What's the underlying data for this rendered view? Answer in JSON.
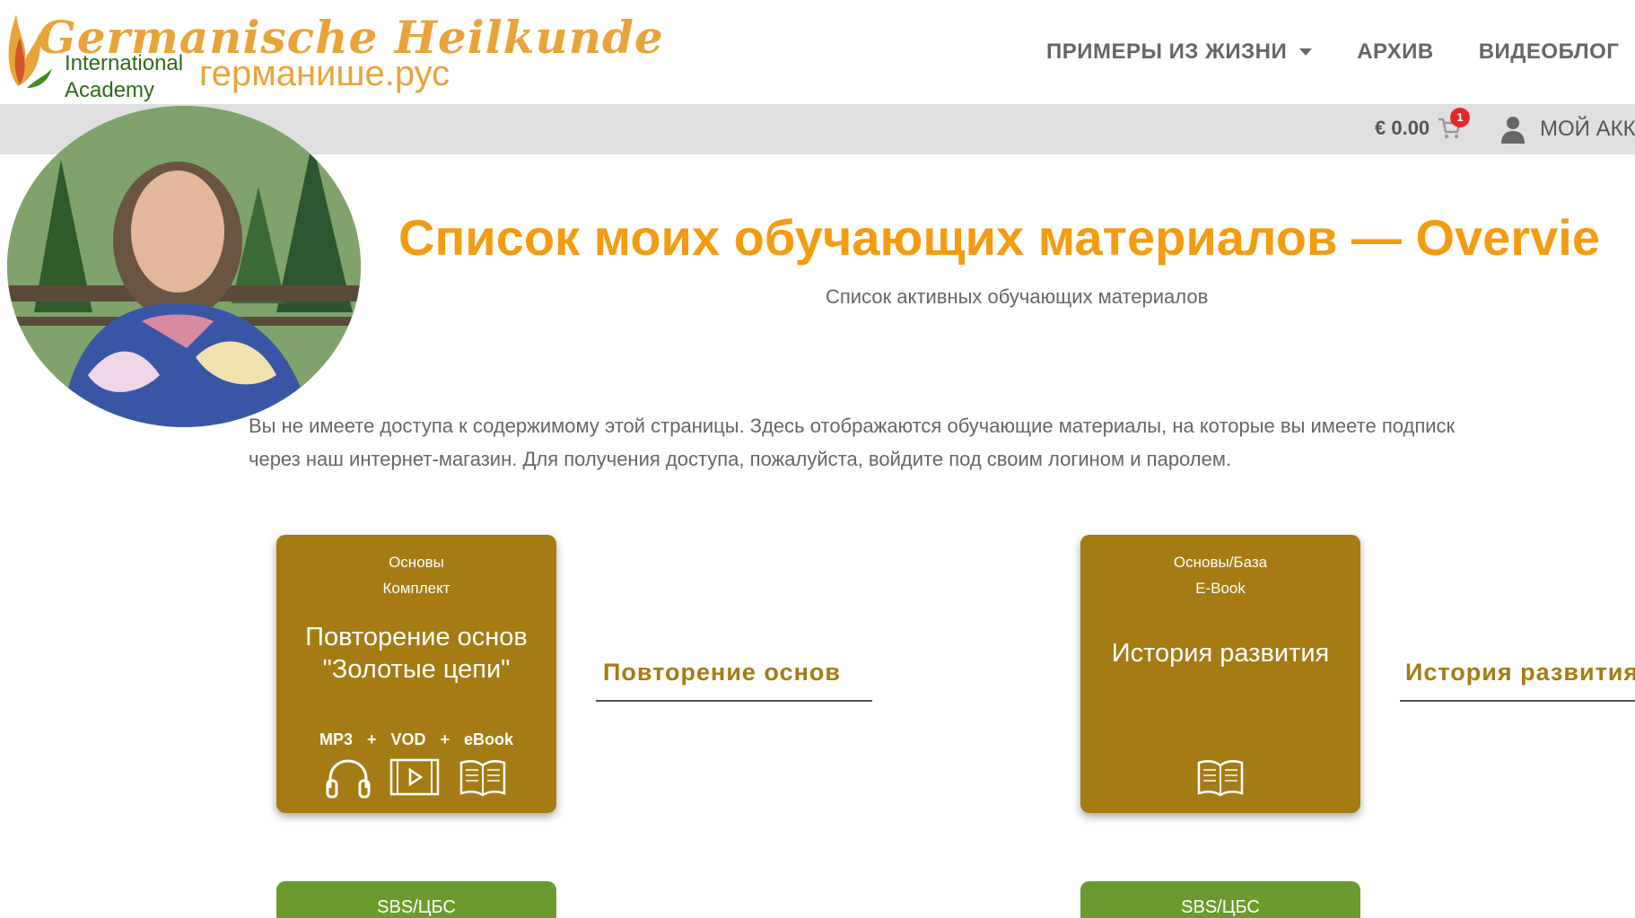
{
  "logo": {
    "main": "Germanische Heilkunde",
    "line1": "International",
    "line2": "Academy",
    "domain": "германише.рус"
  },
  "nav": {
    "items": [
      {
        "label": "ПРИМЕРЫ ИЗ ЖИЗНИ",
        "has_dropdown": true
      },
      {
        "label": "АРХИВ"
      },
      {
        "label": "ВИДЕОБЛОГ"
      }
    ]
  },
  "cart": {
    "amount": "€ 0.00",
    "badge": "1"
  },
  "account": {
    "label": "МОЙ АКК"
  },
  "page": {
    "title": "Список моих обучающих материалов — Overvie",
    "subtitle": "Список активных обучающих материалов",
    "notice_line1": "Вы не имеете доступа к содержимому этой страницы. Здесь отображаются обучающие материалы, на которые вы имеете подписк",
    "notice_line2": "через наш интернет-магазин. Для получения доступа, пожалуйста, войдите под своим логином и паролем."
  },
  "cards": [
    {
      "cat1": "Основы",
      "cat2": "Комплект",
      "name_line1": "Повторение основ",
      "name_line2": "\"Золотые цепи\"",
      "formats": [
        "MP3",
        "+",
        "VOD",
        "+",
        "eBook"
      ],
      "icons": [
        "headphones-icon",
        "video-icon",
        "book-icon"
      ],
      "link": "Повторение основ"
    },
    {
      "cat1": "Основы/База",
      "cat2": "E-Book",
      "name_line1": "История развития",
      "icons": [
        "book-icon"
      ],
      "link": "История развития"
    }
  ],
  "green_cards": [
    {
      "label": "SBS/ЦБС"
    },
    {
      "label": "SBS/ЦБС"
    }
  ],
  "colors": {
    "accent_orange": "#f39c12",
    "card_gold": "#a57c14",
    "card_green": "#6b9b2e",
    "subbar_gray": "#e0e0e0",
    "badge_red": "#e02a2a"
  }
}
